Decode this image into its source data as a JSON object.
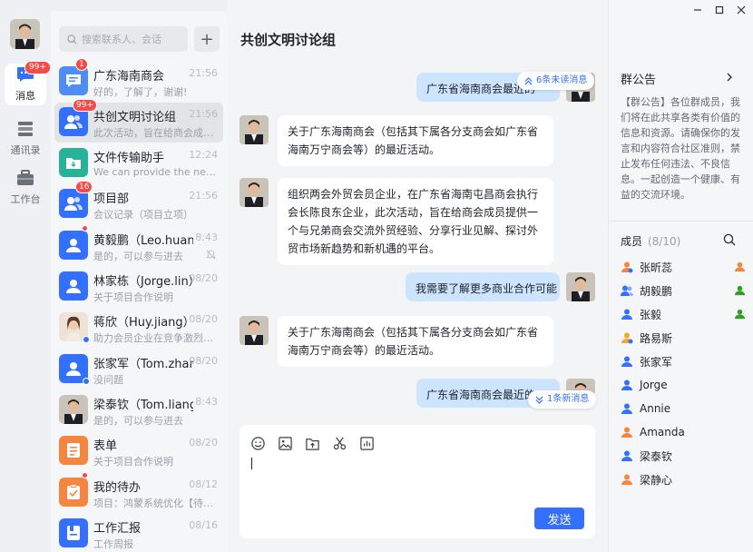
{
  "nav": {
    "items": [
      {
        "label": "消息",
        "badge": "99+"
      },
      {
        "label": "通讯录"
      },
      {
        "label": "工作台"
      }
    ]
  },
  "search": {
    "placeholder": "搜索联系人、会话"
  },
  "conversations": [
    {
      "name": "广东海南商会",
      "time": "21:56",
      "preview": "好的，了解了，谢谢!",
      "badge": "1"
    },
    {
      "name": "共创文明讨论组",
      "time": "21:56",
      "preview": "此次活动，旨在给商会成员提...",
      "badge": "99+"
    },
    {
      "name": "文件传输助手",
      "time": "12:24",
      "preview": "We can provide the new file..."
    },
    {
      "name": "项目部",
      "time": "21:56",
      "preview": "会议记录（项目立项）",
      "badge": "16"
    },
    {
      "name": "黄毅鹏（Leo.huang）",
      "time": "8:43",
      "preview": "是的，可以参与进去"
    },
    {
      "name": "林家栋（Jorge.lin）",
      "time": "08/20",
      "preview": "关于项目合作说明"
    },
    {
      "name": "蒋欣（Huy.jiang）",
      "time": "08/20",
      "preview": "助力会员企业在竞争激烈环境打..."
    },
    {
      "name": "张家军（Tom.zhang）",
      "time": "08/20",
      "preview": "没问题"
    },
    {
      "name": "梁泰钦（Tom.liang）",
      "time": "8:43",
      "preview": "是的，可以参与进去"
    },
    {
      "name": "表单",
      "time": "08/20",
      "preview": "关于项目合作说明"
    },
    {
      "name": "我的待办",
      "time": "08/12",
      "preview": "项目：鸿蒙系统优化【待办】"
    },
    {
      "name": "工作汇报",
      "time": "08/16",
      "preview": "工作周报"
    }
  ],
  "chat": {
    "title": "共创文明讨论组",
    "unread_top": "6条未读消息",
    "unread_bottom": "1条新消息",
    "messages": [
      {
        "side": "out",
        "text": "广东省海南商会最近的"
      },
      {
        "side": "in",
        "text": "关于广东海南商会（包括其下属各分支商会如广东省海南万宁商会等）的最近活动。"
      },
      {
        "side": "in",
        "text": "组织两会外贸会员企业，在广东省海南屯昌商会执行会长陈良东企业，此次活动，旨在给商会成员提供一个与兄弟商会交流外贸经验、分享行业见解、探讨外贸市场新趋势和新机遇的平台。"
      },
      {
        "side": "out",
        "text": "我需要了解更多商业合作可能"
      },
      {
        "side": "in",
        "text": "关于广东海南商会（包括其下属各分支商会如广东省海南万宁商会等）的最近活动。"
      },
      {
        "side": "out",
        "text": "广东省海南商会最近的"
      }
    ],
    "send_label": "发送"
  },
  "announcement": {
    "title": "群公告",
    "text": "【群公告】各位群成员，我们将在此共享各类有价值的信息和资源。请确保你的发言和内容符合社区准则，禁止发布任何违法、不良信息。一起创造一个健康、有益的交流环境。"
  },
  "members": {
    "label": "成员",
    "count": "(8/10)",
    "list": [
      {
        "name": "张昕蕊",
        "icon": "orange-user",
        "role": "owner"
      },
      {
        "name": "胡毅鹏",
        "icon": "group-user",
        "role": "admin"
      },
      {
        "name": "张毅",
        "icon": "blue-user",
        "role": "admin"
      },
      {
        "name": "路易斯",
        "icon": "orange-star-user"
      },
      {
        "name": "张家军",
        "icon": "blue-user"
      },
      {
        "name": "Jorge",
        "icon": "blue-user"
      },
      {
        "name": "Annie",
        "icon": "blue-user"
      },
      {
        "name": "Amanda",
        "icon": "orange-user"
      },
      {
        "name": "梁泰钦",
        "icon": "blue-user"
      },
      {
        "name": "梁静心",
        "icon": "orange-user"
      }
    ]
  },
  "colors": {
    "accent": "#3370ff",
    "badge": "#f54a45",
    "outgoing_bubble": "#cde4ff"
  }
}
